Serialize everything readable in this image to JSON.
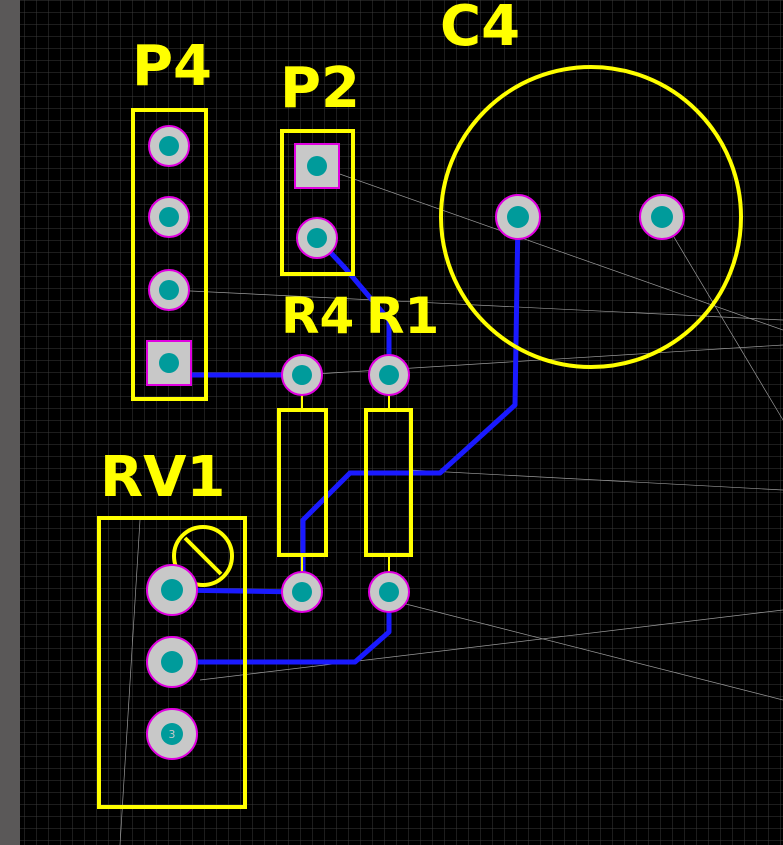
{
  "editor": {
    "colors": {
      "background": "#000000",
      "grid": "#3a3a3a",
      "left_panel": "#5a5858",
      "silkscreen": "#ffff00",
      "copper_trace": "#1a1aff",
      "ratsnest": "#9a9a9a",
      "pad_fill": "#c8c8c8",
      "pad_ring": "#e000e0",
      "pad_hole": "#009b9b"
    }
  },
  "components": [
    {
      "id": "p4",
      "designator": "P4",
      "pads": 4,
      "pad1_shape": "square"
    },
    {
      "id": "p2",
      "designator": "P2",
      "pads": 2,
      "pad1_shape": "square"
    },
    {
      "id": "c4",
      "designator": "C4",
      "pads": 2,
      "outline": "circle"
    },
    {
      "id": "r4",
      "designator": "R4",
      "pads": 2,
      "outline": "rectangle"
    },
    {
      "id": "r1",
      "designator": "R1",
      "pads": 2,
      "outline": "rectangle"
    },
    {
      "id": "rv1",
      "designator": "RV1",
      "pads": 3,
      "pad_labels": [
        "",
        "",
        "3"
      ]
    }
  ]
}
